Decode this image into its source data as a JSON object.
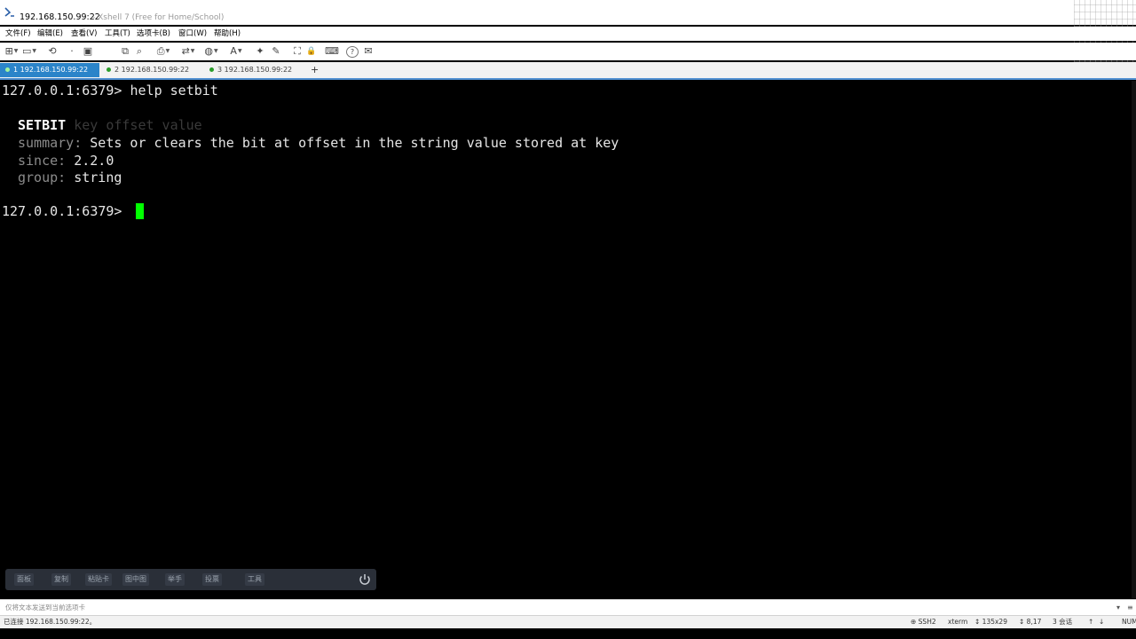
{
  "window": {
    "title": "192.168.150.99:22",
    "subtitle": "- Xshell 7 (Free for Home/School)"
  },
  "menu": [
    {
      "label": "文件(F)"
    },
    {
      "label": "编辑(E)"
    },
    {
      "label": "查看(V)"
    },
    {
      "label": "工具(T)"
    },
    {
      "label": "选项卡(B)"
    },
    {
      "label": "窗口(W)"
    },
    {
      "label": "帮助(H)"
    }
  ],
  "toolbar": [
    {
      "icon": "new-session-icon",
      "glyph": "⊞"
    },
    {
      "icon": "open-folder-icon",
      "glyph": "▭"
    },
    {
      "icon": "reconnect-icon",
      "glyph": "⟲"
    },
    {
      "icon": "disconnect-icon",
      "glyph": "·"
    },
    {
      "icon": "properties-icon",
      "glyph": "▣"
    },
    {
      "icon": "copy-icon",
      "glyph": "⧉"
    },
    {
      "icon": "find-icon",
      "glyph": "⌕"
    },
    {
      "icon": "print-icon",
      "glyph": "⎙"
    },
    {
      "icon": "transfer-icon",
      "glyph": "⇄"
    },
    {
      "icon": "globe-icon",
      "glyph": "◍"
    },
    {
      "icon": "font-icon",
      "glyph": "A"
    },
    {
      "icon": "script-icon",
      "glyph": "✦"
    },
    {
      "icon": "compose-icon",
      "glyph": "✎"
    },
    {
      "icon": "fullscreen-icon",
      "glyph": "⛶"
    },
    {
      "icon": "lock-icon",
      "glyph": "🔒"
    },
    {
      "icon": "keyboard-icon",
      "glyph": "⌨"
    },
    {
      "icon": "help-icon",
      "glyph": "?"
    },
    {
      "icon": "chat-icon",
      "glyph": "✉"
    }
  ],
  "tabs": [
    {
      "label": "1 192.168.150.99:22",
      "active": true
    },
    {
      "label": "2 192.168.150.99:22",
      "active": false
    },
    {
      "label": "3 192.168.150.99:22",
      "active": false
    }
  ],
  "tab_add_label": "+",
  "terminal": {
    "prompt1": "127.0.0.1:6379> ",
    "command": "help setbit",
    "cmd_name": "SETBIT",
    "cmd_args": "key offset value",
    "summary_label": "summary: ",
    "summary_value": "Sets or clears the bit at offset in the string value stored at key",
    "since_label": "since: ",
    "since_value": "2.2.0",
    "group_label": "group: ",
    "group_value": "string",
    "prompt2": "127.0.0.1:6379> ",
    "cursor_color": "#00ff00"
  },
  "quickbar": [
    {
      "label": "面板"
    },
    {
      "label": "复制"
    },
    {
      "label": "粘贴卡"
    },
    {
      "label": "图中图"
    },
    {
      "label": "举手"
    },
    {
      "label": "投票"
    },
    {
      "label": "工具"
    }
  ],
  "sendbar": {
    "text": "仅将文本发送到当前选项卡",
    "ctrl1": "▾",
    "ctrl2": "≡"
  },
  "statusbar": {
    "connection": "已连接 192.168.150.99:22。",
    "protocol": "SSH2",
    "terminal_type": "xterm",
    "size": "135x29",
    "position": "8,17",
    "sessions": "3 会话",
    "num": "NUM"
  },
  "colors": {
    "tab_active": "#2b84c9",
    "terminal_bg": "#000000",
    "terminal_fg": "#e6e6e6",
    "label_gray": "#8b8b8b"
  }
}
